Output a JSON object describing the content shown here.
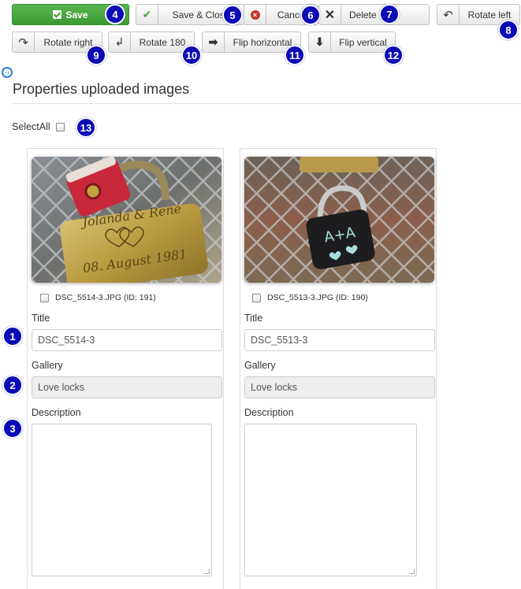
{
  "toolbar": {
    "save": "Save",
    "save_close": "Save & Close",
    "cancel": "Cancel",
    "delete": "Delete",
    "rotate_left": "Rotate left",
    "rotate_right": "Rotate right",
    "rotate_180": "Rotate 180",
    "flip_horizontal": "Flip horizontal",
    "flip_vertical": "Flip vertical"
  },
  "page": {
    "title": "Properties uploaded images",
    "select_all": "SelectAll"
  },
  "images": [
    {
      "filename": "DSC_5514-3.JPG (ID: 191)",
      "title_label": "Title",
      "title_value": "DSC_5514-3",
      "gallery_label": "Gallery",
      "gallery_value": "Love locks",
      "description_label": "Description",
      "lock_text_1": "Jolanda & René",
      "lock_text_2": "08. August 1981"
    },
    {
      "filename": "DSC_5513-3.JPG (ID: 190)",
      "title_label": "Title",
      "title_value": "DSC_5513-3",
      "gallery_label": "Gallery",
      "gallery_value": "Love locks",
      "description_label": "Description",
      "lock_text_1": "A+A"
    }
  ],
  "badges": [
    "1",
    "2",
    "3",
    "4",
    "5",
    "6",
    "7",
    "8",
    "9",
    "10",
    "11",
    "12",
    "13"
  ],
  "colors": {
    "save_green": "#46a53d",
    "badge_blue": "#0b0bb6",
    "link_blue": "#2a7fd4"
  },
  "icons": [
    "check-icon",
    "cancel-circle-icon",
    "close-x-icon",
    "rotate-left-icon",
    "rotate-right-icon",
    "return-arrow-icon",
    "arrow-right-icon",
    "arrow-down-icon"
  ]
}
